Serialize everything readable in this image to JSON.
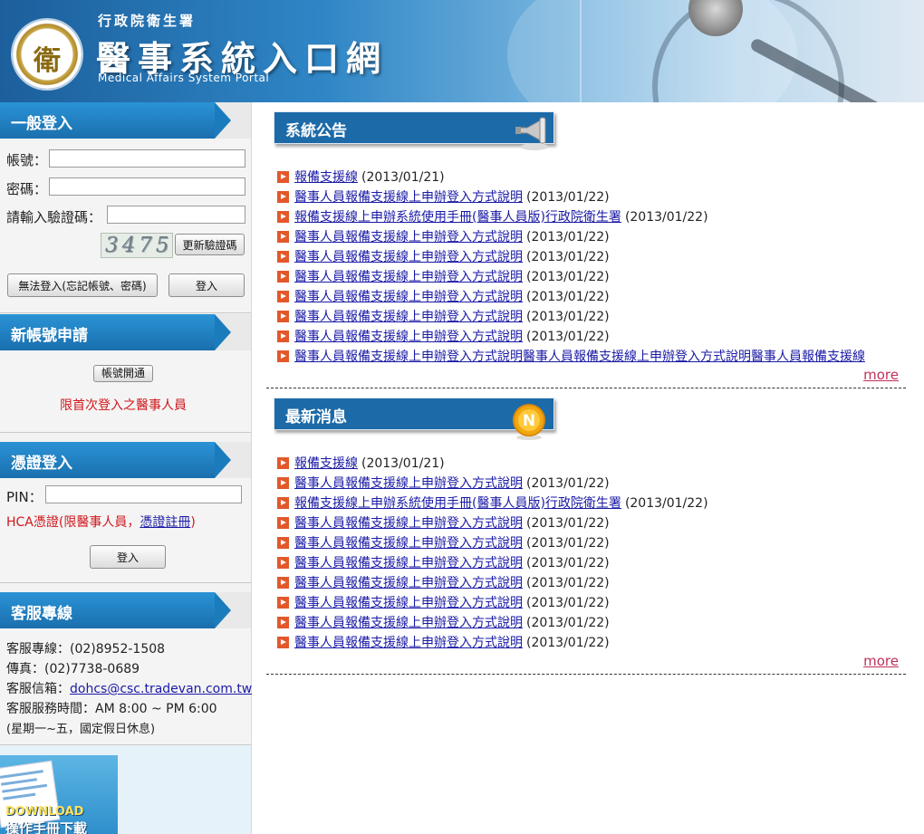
{
  "header": {
    "org_name": "行政院衛生署",
    "title": "醫事系統入口網",
    "subtitle_en": "Medical Affairs System Portal",
    "logo_glyph": "衛"
  },
  "login": {
    "heading": "一般登入",
    "account_label": "帳號：",
    "account_value": "",
    "password_label": "密碼：",
    "password_value": "",
    "captcha_label": "請輸入驗證碼：",
    "captcha_value": "",
    "captcha_image_text": "3475",
    "refresh_captcha_button": "更新驗證碼",
    "forgot_button": "無法登入(忘記帳號、密碼)",
    "login_button": "登入"
  },
  "new_account": {
    "heading": "新帳號申請",
    "open_button": "帳號開通",
    "note": "限首次登入之醫事人員"
  },
  "cert_login": {
    "heading": "憑證登入",
    "pin_label": "PIN：",
    "pin_value": "",
    "note_prefix": "HCA憑證(限醫事人員，",
    "note_link": "憑證註冊",
    "note_suffix": ")",
    "login_button": "登入"
  },
  "support": {
    "heading": "客服專線",
    "phone": "客服專線：(02)8952-1508",
    "fax": "傳真：(02)7738-0689",
    "email_label": "客服信箱：",
    "email": "dohcs@csc.tradevan.com.tw",
    "hours": "客服服務時間：AM 8:00 ~ PM 6:00",
    "days": "(星期一~五，國定假日休息)"
  },
  "download": {
    "label_en": "DOWNLOAD",
    "label_zh": "操作手冊下載"
  },
  "announcements": {
    "heading": "系統公告",
    "more": "more",
    "items": [
      {
        "title": "報備支援線",
        "date": "(2013/01/21)"
      },
      {
        "title": "醫事人員報備支援線上申辦登入方式說明",
        "date": "(2013/01/22)"
      },
      {
        "title": "報備支援線上申辦系統使用手冊(醫事人員版)行政院衛生署",
        "date": "(2013/01/22)"
      },
      {
        "title": "醫事人員報備支援線上申辦登入方式說明",
        "date": "(2013/01/22)"
      },
      {
        "title": "醫事人員報備支援線上申辦登入方式說明",
        "date": "(2013/01/22)"
      },
      {
        "title": "醫事人員報備支援線上申辦登入方式說明",
        "date": "(2013/01/22)"
      },
      {
        "title": "醫事人員報備支援線上申辦登入方式說明",
        "date": "(2013/01/22)"
      },
      {
        "title": "醫事人員報備支援線上申辦登入方式說明",
        "date": "(2013/01/22)"
      },
      {
        "title": "醫事人員報備支援線上申辦登入方式說明",
        "date": "(2013/01/22)"
      },
      {
        "title": "醫事人員報備支援線上申辦登入方式說明醫事人員報備支援線上申辦登入方式說明醫事人員報備支援線",
        "date": ""
      }
    ]
  },
  "latest_news": {
    "heading": "最新消息",
    "more": "more",
    "items": [
      {
        "title": "報備支援線",
        "date": "(2013/01/21)"
      },
      {
        "title": "醫事人員報備支援線上申辦登入方式說明",
        "date": "(2013/01/22)"
      },
      {
        "title": "報備支援線上申辦系統使用手冊(醫事人員版)行政院衛生署",
        "date": "(2013/01/22)"
      },
      {
        "title": "醫事人員報備支援線上申辦登入方式說明",
        "date": "(2013/01/22)"
      },
      {
        "title": "醫事人員報備支援線上申辦登入方式說明",
        "date": "(2013/01/22)"
      },
      {
        "title": "醫事人員報備支援線上申辦登入方式說明",
        "date": "(2013/01/22)"
      },
      {
        "title": "醫事人員報備支援線上申辦登入方式說明",
        "date": "(2013/01/22)"
      },
      {
        "title": "醫事人員報備支援線上申辦登入方式說明",
        "date": "(2013/01/22)"
      },
      {
        "title": "醫事人員報備支援線上申辦登入方式說明",
        "date": "(2013/01/22)"
      },
      {
        "title": "醫事人員報備支援線上申辦登入方式說明",
        "date": "(2013/01/22)"
      }
    ]
  },
  "colors": {
    "panel_blue": "#1f7fc0",
    "section_blue": "#1d6aa8",
    "bullet_orange": "#e2582b",
    "note_red": "#d0161b",
    "more_pink": "#c0305a"
  }
}
